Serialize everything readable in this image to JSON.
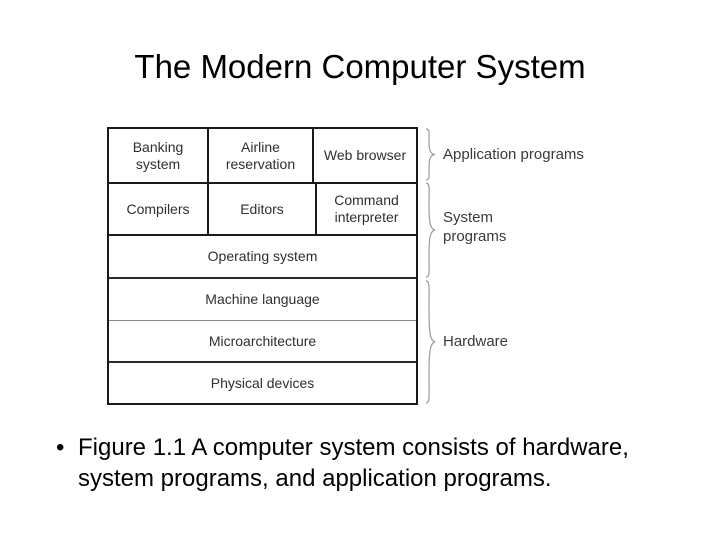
{
  "slide": {
    "title": "The Modern Computer System",
    "background_color": "#ffffff",
    "text_color": "#000000"
  },
  "figure": {
    "name": "computer-system-layer-stack",
    "box_border_color": "#1a1a1a",
    "brace_color": "#9a9a9a",
    "label_color": "#3a3a3a",
    "rows": [
      {
        "group": "application-programs",
        "cells": [
          {
            "label": "Banking\nsystem"
          },
          {
            "label": "Airline\nreservation"
          },
          {
            "label": "Web\nbrowser"
          }
        ]
      },
      {
        "group": "system-programs",
        "cells": [
          {
            "label": "Compilers"
          },
          {
            "label": "Editors"
          },
          {
            "label": "Command\ninterpreter"
          }
        ]
      },
      {
        "group": "system-programs",
        "cells": [
          {
            "label": "Operating system"
          }
        ]
      },
      {
        "group": "hardware",
        "cells": [
          {
            "label": "Machine language"
          }
        ]
      },
      {
        "group": "hardware",
        "cells": [
          {
            "label": "Microarchitecture"
          }
        ]
      },
      {
        "group": "hardware",
        "cells": [
          {
            "label": "Physical devices"
          }
        ]
      }
    ],
    "cells": {
      "r1c1": "Banking\nsystem",
      "r1c2": "Airline\nreservation",
      "r1c3": "Web\nbrowser",
      "r2c1": "Compilers",
      "r2c2": "Editors",
      "r2c3": "Command\ninterpreter",
      "r3c1": "Operating system",
      "r4c1": "Machine language",
      "r5c1": "Microarchitecture",
      "r6c1": "Physical devices"
    },
    "braces": [
      {
        "name": "application-programs",
        "label": "Application programs",
        "spans_rows": [
          1
        ]
      },
      {
        "name": "system-programs",
        "label": "System\nprograms",
        "spans_rows": [
          2,
          3
        ]
      },
      {
        "name": "hardware",
        "label": "Hardware",
        "spans_rows": [
          4,
          5,
          6
        ]
      }
    ],
    "brace_labels": {
      "application": "Application programs",
      "system": "System\nprograms",
      "hardware": "Hardware"
    }
  },
  "caption": {
    "bullet": "•",
    "text": "Figure 1.1 A computer system consists of hardware, system programs, and application programs."
  }
}
